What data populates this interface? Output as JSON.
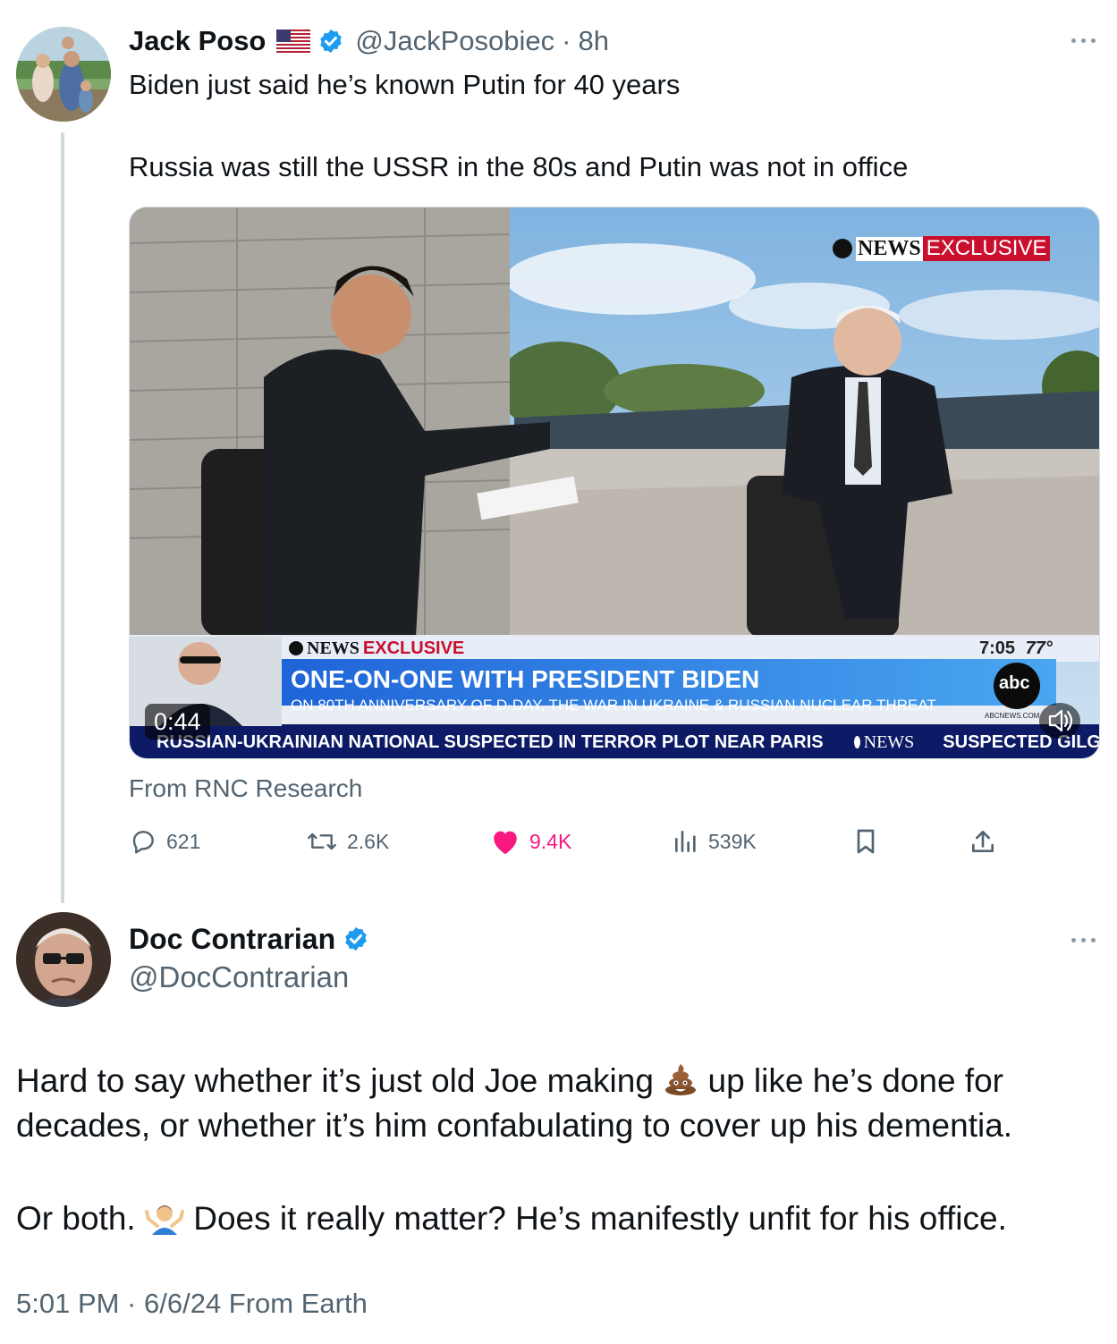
{
  "original_tweet": {
    "author_name": "Jack Poso",
    "flag": "🇺🇸",
    "handle": "@JackPosobiec",
    "separator": "·",
    "time_ago": "8h",
    "text_line1": "Biden just said he’s known Putin for 40 years",
    "text_line2": "Russia was still the USSR in the 80s and Putin was not in office",
    "media": {
      "corner_network": "NEWS",
      "corner_badge": "EXCLUSIVE",
      "lower_label_network": "NEWS",
      "lower_label_exclusive": "EXCLUSIVE",
      "headline": "ONE-ON-ONE WITH PRESIDENT BIDEN",
      "subheadline": "ON 80TH ANNIVERSARY OF D-DAY, THE WAR IN UKRAINE & RUSSIAN NUCLEAR THREAT",
      "clock": "7:05",
      "temperature": "77°",
      "logo_text": "abc",
      "logo_url_text": "ABCNEWS.COM",
      "ticker_text": "RUSSIAN-UKRAINIAN NATIONAL SUSPECTED IN TERROR PLOT NEAR PARIS",
      "ticker_network": "NEWS",
      "ticker_text_2": "SUSPECTED GILG",
      "duration": "0:44"
    },
    "attribution": "From RNC Research",
    "actions": {
      "replies": "621",
      "reposts": "2.6K",
      "likes": "9.4K",
      "views": "539K"
    }
  },
  "reply_tweet": {
    "author_name": "Doc Contrarian",
    "handle": "@DocContrarian",
    "text_line1_a": "Hard to say whether it’s just old Joe making",
    "text_line1_b": "up like he’s done for",
    "text_line2": "decades, or whether it’s him confabulating to cover up his dementia.",
    "text_line3_a": "Or both.",
    "text_line3_b": "Does it really matter? He’s manifestly unfit for his office.",
    "emoji_1": "poop-emoji",
    "emoji_2": "person-shrugging-emoji",
    "footer": "5:01 PM · 6/6/24 From Earth"
  },
  "colors": {
    "text_primary": "#0f1419",
    "text_secondary": "#536471",
    "verified_blue": "#1d9bf0",
    "like_pink": "#f91880",
    "thread_line": "#cfd9de"
  }
}
